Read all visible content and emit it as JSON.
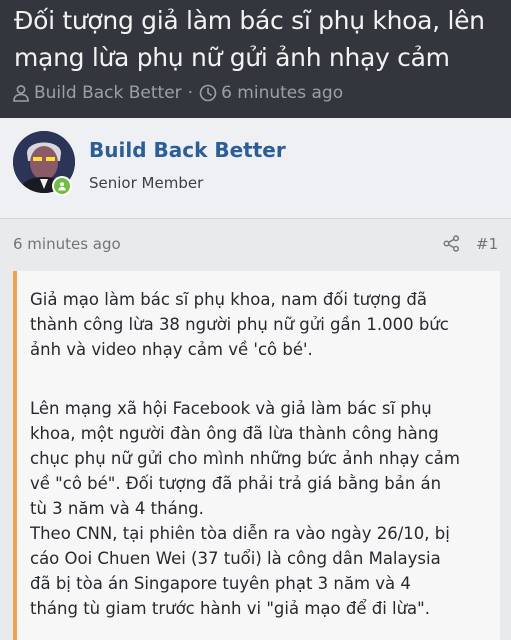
{
  "thread": {
    "title": "Đối tượng giả làm bác sĩ phụ khoa, lên mạng lừa phụ nữ gửi ảnh nhạy cảm",
    "author": "Build Back Better",
    "separator": "·",
    "time": "6 minutes ago"
  },
  "post": {
    "username": "Build Back Better",
    "user_title": "Senior Member",
    "time": "6 minutes ago",
    "number": "#1",
    "paragraph1": "Giả mạo làm bác sĩ phụ khoa, nam đối tượng đã\nthành công lừa 38 người phụ nữ gửi gần 1.000 bức\nảnh và video nhạy cảm về 'cô bé'.",
    "paragraph2": "Lên mạng xã hội Facebook và giả làm bác sĩ phụ\nkhoa, một người đàn ông đã lừa thành công hàng\nchục phụ nữ gửi cho mình những bức ảnh nhạy cảm\nvề \"cô bé\". Đối tượng đã phải trả giá bằng bản án\ntù 3 năm và 4 tháng.\nTheo CNN, tại phiên tòa diễn ra vào ngày 26/10, bị\ncáo Ooi Chuen Wei (37 tuổi) là công dân Malaysia\nđã bị tòa án Singapore tuyên phạt 3 năm và 4\ntháng tù giam trước hành vi \"giả mạo để đi lừa\"."
  },
  "colors": {
    "header_bg": "#33373d",
    "username": "#2b5e97",
    "quote_border": "#f0a050",
    "online": "#6fbe44"
  },
  "icons": [
    "user-icon",
    "clock-icon",
    "share-icon",
    "online-badge-icon"
  ]
}
